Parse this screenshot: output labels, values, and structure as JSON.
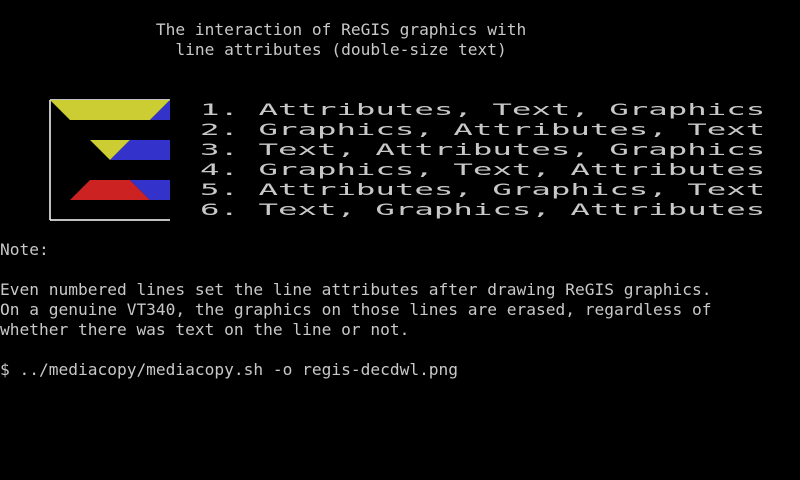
{
  "terminal": {
    "heading": [
      "                The interaction of ReGIS graphics with",
      "                  line attributes (double-size text)"
    ],
    "double_lines": [
      "1. Attributes, Text, Graphics",
      "2. Graphics, Attributes, Text",
      "3. Text, Attributes, Graphics",
      "4. Graphics, Text, Attributes",
      "5. Attributes, Graphics, Text",
      "6. Text, Graphics, Attributes"
    ],
    "note_label": "Note:",
    "note_text": [
      "Even numbered lines set the line attributes after drawing ReGIS graphics.",
      "On a genuine VT340, the graphics on those lines are erased, regardless of",
      "whether there was text on the line or not."
    ],
    "command": "$ ../mediacopy/mediacopy.sh -o regis-decdwl.png"
  },
  "colors": {
    "background": "#000000",
    "text": "#c8c8c8",
    "frame": "#ffffff",
    "yellow": "#cccc33",
    "blue": "#3333cc",
    "red": "#cc2222"
  }
}
